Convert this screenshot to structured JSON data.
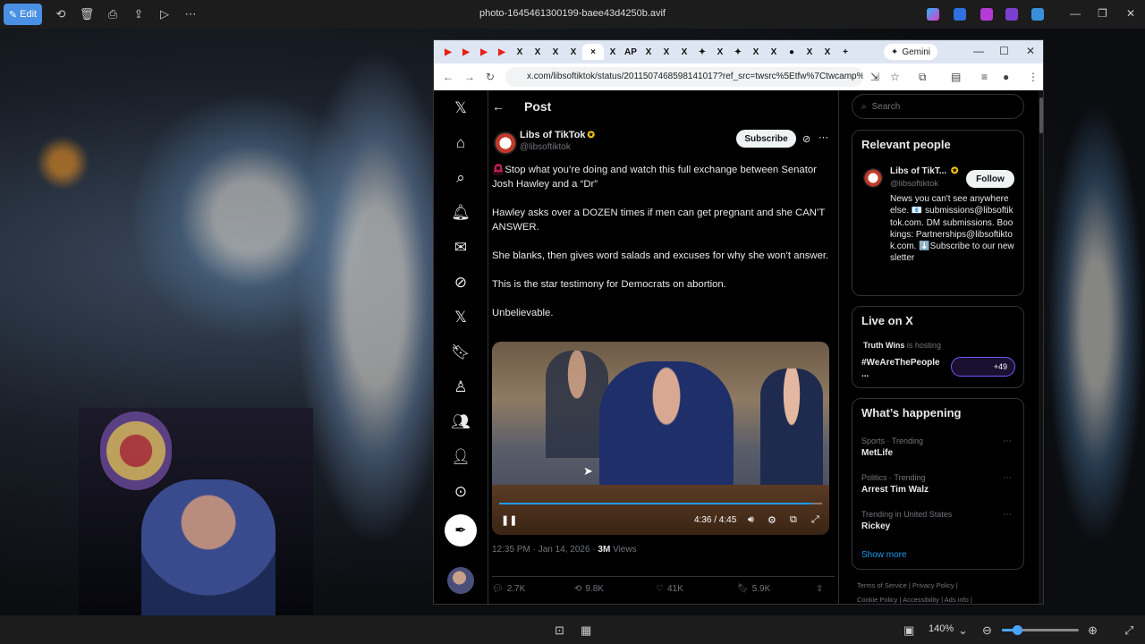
{
  "viewer": {
    "edit_label": "Edit",
    "title": "photo-1645461300199-baee43d4250b.avif",
    "zoom_label": "140%",
    "zoom_level": 0.2
  },
  "browser": {
    "gemini_label": "Gemini",
    "url": "x.com/libsoftiktok/status/2011507468598141017?ref_src=twsrc%5Etfw%7Ctwcamp%5Etw...",
    "tabs": [
      "▶",
      "▶",
      "▶",
      "▶",
      "X",
      "X",
      "X",
      "X",
      "×",
      "X",
      "AP",
      "X",
      "X",
      "X",
      "✦",
      "X",
      "✦",
      "X",
      "X",
      "●",
      "X",
      "X"
    ]
  },
  "post": {
    "header_title": "Post",
    "author_name": "Libs of TikTok",
    "author_handle": "@libsoftiktok",
    "subscribe_label": "Subscribe",
    "paragraphs": [
      "Stop what you’re doing and watch this full exchange between Senator Josh Hawley and a “Dr”",
      "Hawley asks over a DOZEN times if men can get pregnant and she CAN’T ANSWER.",
      "She blanks, then gives word salads and excuses for why she won’t answer.",
      "This is the star testimony for Democrats on abortion.",
      "Unbelievable."
    ],
    "video_time": "4:36 / 4:45",
    "video_progress": 0.97,
    "timestamp": "12:35 PM · Jan 14, 2026 · ",
    "views_count": "3M",
    "views_label": " Views",
    "replies": "2.7K",
    "reposts": "9.8K",
    "likes": "41K",
    "bookmarks": "5.9K"
  },
  "sidebar": {
    "search_placeholder": "Search",
    "relevant_title": "Relevant people",
    "rp_name": "Libs of TikT...",
    "rp_handle": "@libsoftiktok",
    "follow_label": "Follow",
    "rp_bio": "News you can't see anywhere else. 📧 submissions@libsoftiktok.com. DM submissions. Bookings: Partnerships@libsoftiktok.com. ⬇️Subscribe to our newsletter",
    "live_title": "Live on X",
    "live_host": "Truth Wins",
    "live_hosting": " is hosting",
    "live_tag": "#WeAreThePeople ...",
    "live_count": "+49",
    "happening_title": "What’s happening",
    "trends": [
      {
        "category": "Sports · Trending",
        "name": "MetLife"
      },
      {
        "category": "Politics · Trending",
        "name": "Arrest Tim Walz"
      },
      {
        "category": "Trending in United States",
        "name": "Rickey"
      }
    ],
    "show_more": "Show more",
    "footer_1": "Terms of Service  |  Privacy Policy  |",
    "footer_2": "Cookie Policy  |  Accessibility  |  Ads info  |"
  },
  "colors": {
    "accent": "#1d9bf0",
    "viewer_edit": "#4a90e2"
  }
}
